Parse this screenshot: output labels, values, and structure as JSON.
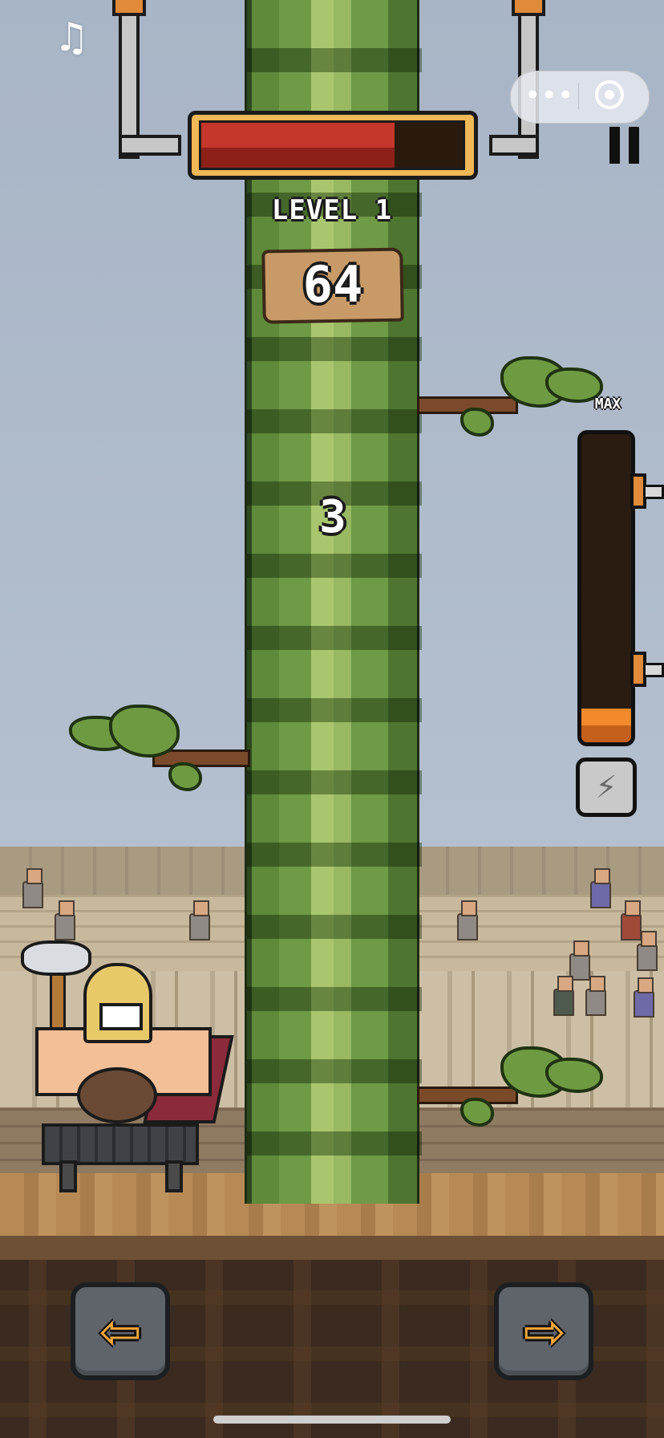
{
  "hud": {
    "level_label": "LEVEL 1",
    "score": "64",
    "combo": "3",
    "time_bar_fraction": 0.74,
    "max_label": "MAX",
    "power_meter_fraction": 0.11
  },
  "icons": {
    "music": "music-note-icon",
    "more": "more-dots-icon",
    "target": "target-icon",
    "pause": "pause-icon",
    "boost": "lightning-icon",
    "left": "left-arrow-icon",
    "right": "right-arrow-icon"
  },
  "glyphs": {
    "music": "♫",
    "more": "•••",
    "boost": "⚡",
    "left": "⇦",
    "right": "⇨"
  },
  "colors": {
    "sky": "#a8b5c6",
    "trunk": "#6f9a46",
    "time_bar_fill": "#c5372b",
    "power_meter_fill": "#f28a2c",
    "arrow": "#f0a63a"
  }
}
